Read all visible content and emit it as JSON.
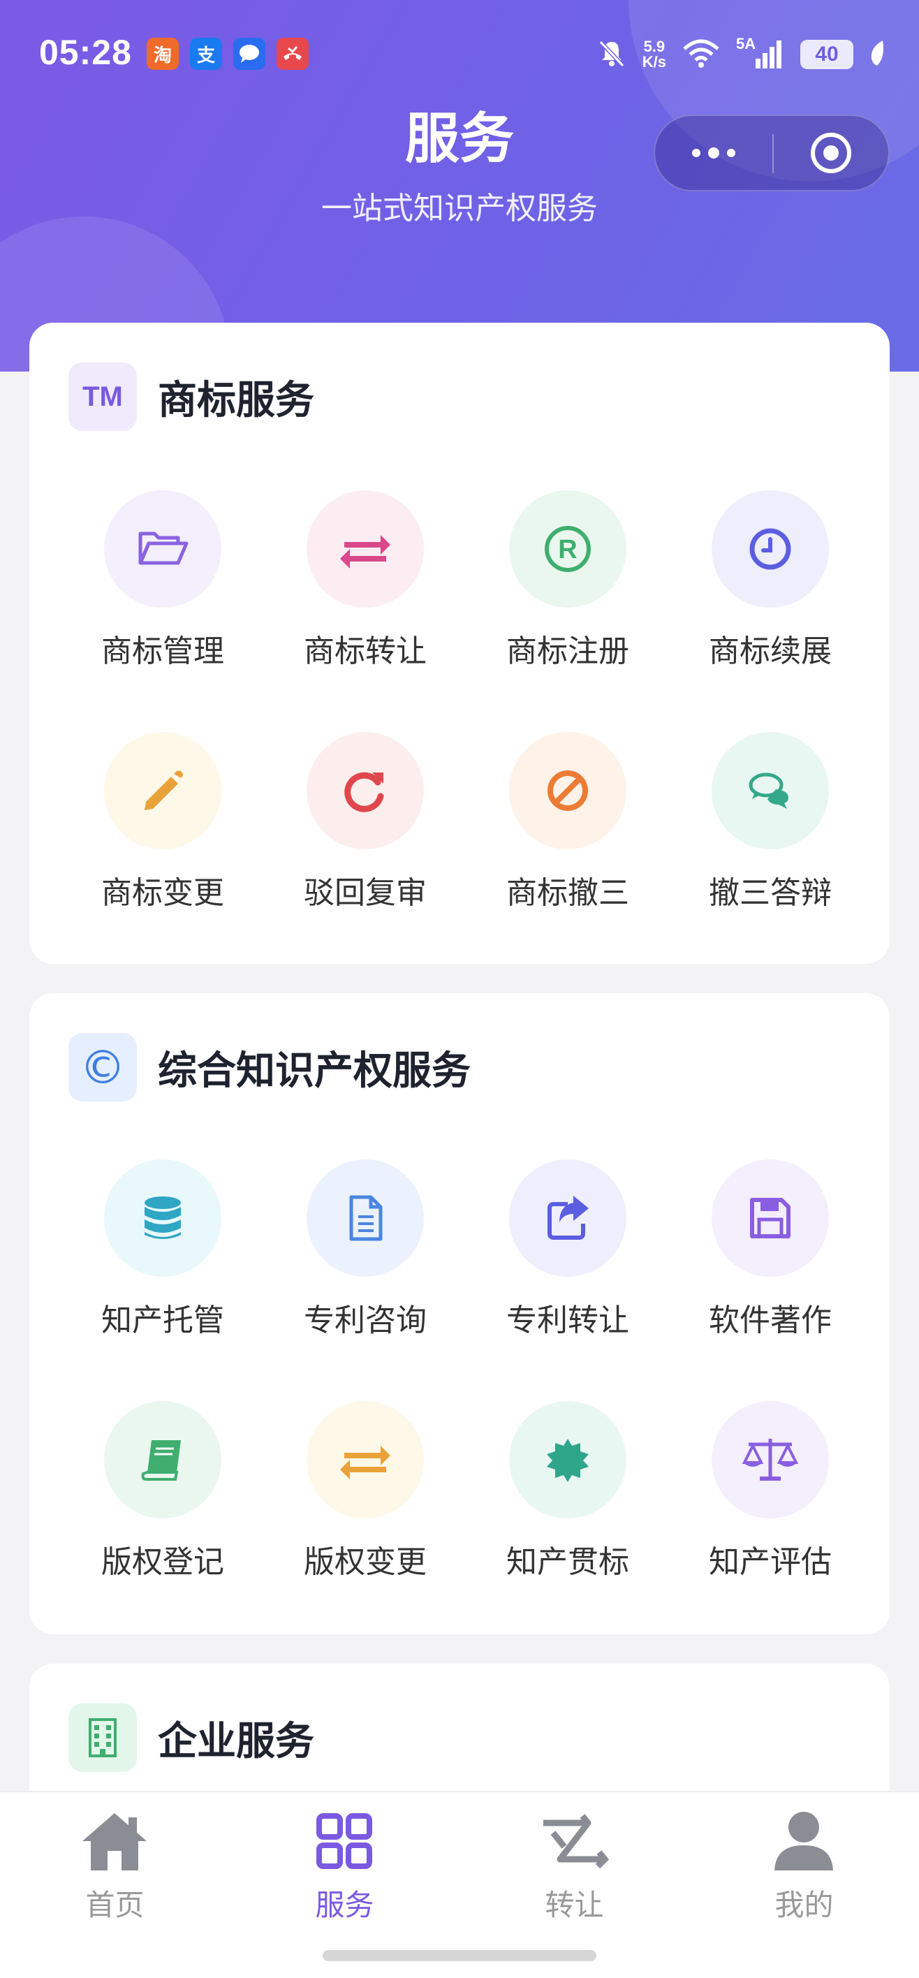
{
  "status_bar": {
    "time": "05:28",
    "apps": [
      {
        "name": "taobao",
        "glyph": "淘",
        "color": "#f06a2a"
      },
      {
        "name": "alipay",
        "glyph": "支",
        "color": "#1a7af0"
      },
      {
        "name": "messages",
        "glyph": "",
        "color": "#2a6cf0"
      },
      {
        "name": "phone-missed",
        "glyph": "",
        "color": "#e8474c"
      }
    ],
    "speed_value": "5.9",
    "speed_unit": "K/s",
    "network": "5A",
    "battery": "40"
  },
  "header": {
    "title": "服务",
    "subtitle": "一站式知识产权服务"
  },
  "sections": [
    {
      "title": "商标服务",
      "icon_text": "TM",
      "icon_color": "#7a5ae0",
      "icon_bg": "#efeafc",
      "items": [
        {
          "label": "商标管理",
          "icon": "folder-open-icon",
          "color": "#8a63e0",
          "bg": "#f3effd"
        },
        {
          "label": "商标转让",
          "icon": "exchange-arrows-icon",
          "color": "#d9488a",
          "bg": "#fcedf3"
        },
        {
          "label": "商标注册",
          "icon": "registered-icon",
          "color": "#3fae6f",
          "bg": "#eaf7ef"
        },
        {
          "label": "商标续展",
          "icon": "clock-icon",
          "color": "#5b5ee0",
          "bg": "#eeeefc"
        },
        {
          "label": "商标变更",
          "icon": "pencil-icon",
          "color": "#e9a23a",
          "bg": "#fef8e8"
        },
        {
          "label": "驳回复审",
          "icon": "redo-icon",
          "color": "#e0474c",
          "bg": "#fdeeee"
        },
        {
          "label": "商标撤三",
          "icon": "ban-icon",
          "color": "#ec7b35",
          "bg": "#fef2e9"
        },
        {
          "label": "撤三答辩",
          "icon": "comments-icon",
          "color": "#35a88a",
          "bg": "#e9f7f3"
        }
      ]
    },
    {
      "title": "综合知识产权服务",
      "icon_text": "©",
      "icon_color": "#3f7fe0",
      "icon_bg": "#e5efff",
      "items": [
        {
          "label": "知产托管",
          "icon": "database-icon",
          "color": "#2fa6c4",
          "bg": "#e8f8fb"
        },
        {
          "label": "专利咨询",
          "icon": "document-icon",
          "color": "#4a85e0",
          "bg": "#ebf2fd"
        },
        {
          "label": "专利转让",
          "icon": "share-square-icon",
          "color": "#5b5ee0",
          "bg": "#eeeefc"
        },
        {
          "label": "软件著作",
          "icon": "floppy-disk-icon",
          "color": "#8a5ee0",
          "bg": "#f3effd"
        },
        {
          "label": "版权登记",
          "icon": "book-icon",
          "color": "#3fae6f",
          "bg": "#eaf7ef"
        },
        {
          "label": "版权变更",
          "icon": "exchange-arrows-icon",
          "color": "#e9a23a",
          "bg": "#fef8e8"
        },
        {
          "label": "知产贯标",
          "icon": "certificate-icon",
          "color": "#2fa68a",
          "bg": "#e9f7f3"
        },
        {
          "label": "知产评估",
          "icon": "balance-scale-icon",
          "color": "#8a5ee0",
          "bg": "#f3effd"
        }
      ]
    },
    {
      "title": "企业服务",
      "icon_text": "",
      "icon_color": "#3fae6f",
      "icon_bg": "#e3f6ea",
      "items": []
    }
  ],
  "tabbar": {
    "tabs": [
      {
        "label": "首页",
        "icon": "home-icon",
        "active": false
      },
      {
        "label": "服务",
        "icon": "grid-icon",
        "active": true
      },
      {
        "label": "转让",
        "icon": "transfer-icon",
        "active": false
      },
      {
        "label": "我的",
        "icon": "user-icon",
        "active": false
      }
    ]
  }
}
